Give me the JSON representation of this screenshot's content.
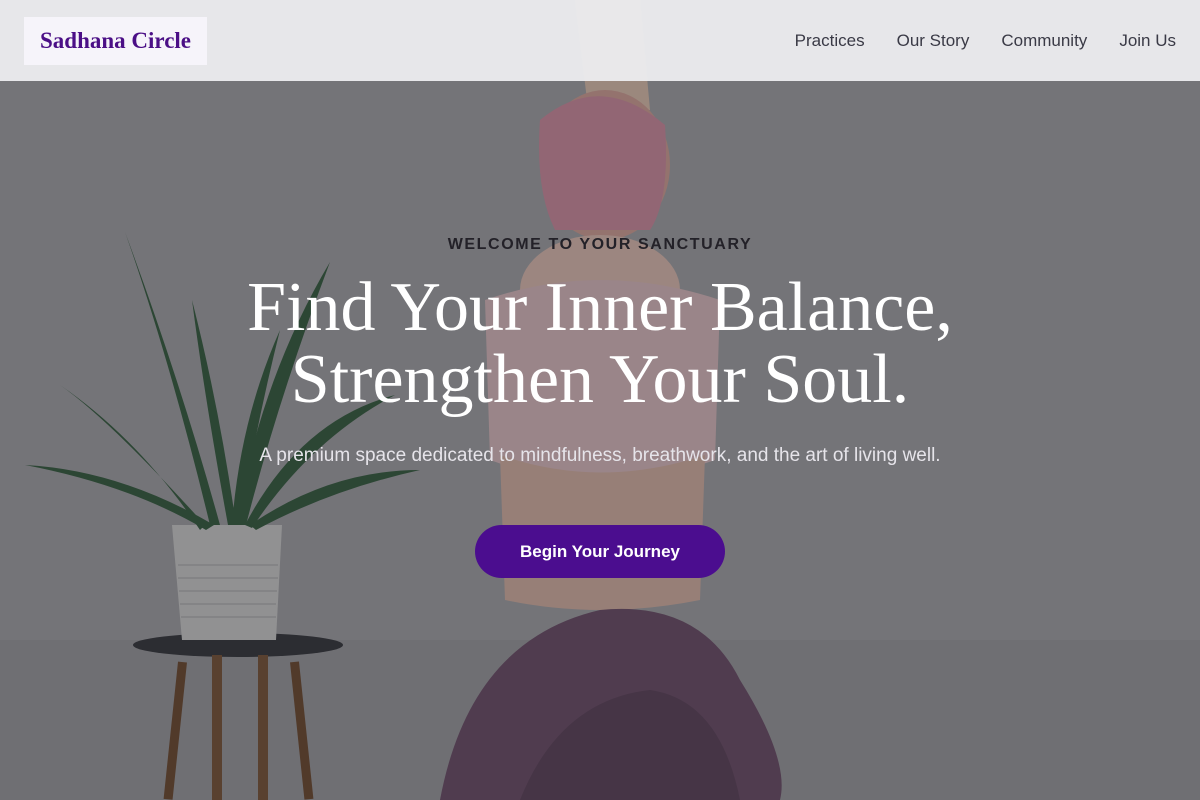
{
  "brand": {
    "name": "Sadhana Circle",
    "accent": "#4b0d8f"
  },
  "nav": {
    "items": [
      {
        "label": "Practices"
      },
      {
        "label": "Our Story"
      },
      {
        "label": "Community"
      },
      {
        "label": "Join Us"
      }
    ]
  },
  "hero": {
    "eyebrow": "WELCOME TO YOUR SANCTUARY",
    "headline_line1": "Find Your Inner Balance,",
    "headline_line2": "Strengthen Your Soul.",
    "subtext": "A premium space dedicated to mindfulness, breathwork, and the art of living well.",
    "cta_label": "Begin Your Journey"
  }
}
